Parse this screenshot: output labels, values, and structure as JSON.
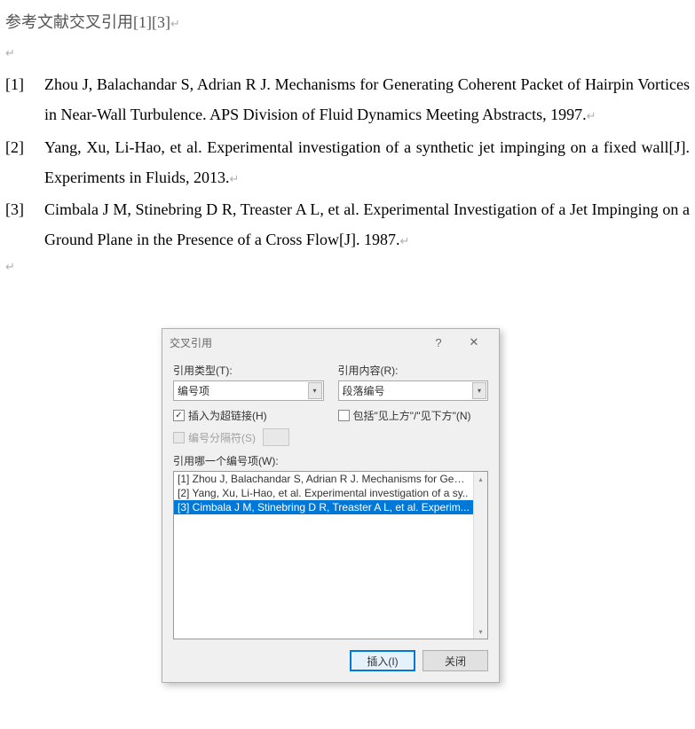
{
  "document": {
    "heading": "参考文献交叉引用[1][3]",
    "references": [
      {
        "num": "[1]",
        "text": "Zhou J, Balachandar S, Adrian R J. Mechanisms for Generating Coherent Packet of Hairpin Vortices in Near-Wall Turbulence. APS Division of Fluid Dynamics Meeting Abstracts, 1997."
      },
      {
        "num": "[2]",
        "text": "Yang, Xu, Li-Hao, et al. Experimental investigation of a synthetic jet impinging on a fixed wall[J]. Experiments in Fluids, 2013."
      },
      {
        "num": "[3]",
        "text": "Cimbala J M, Stinebring D R, Treaster A L, et al. Experimental Investigation of a Jet Impinging on a Ground Plane in the Presence of a Cross Flow[J]. 1987."
      }
    ],
    "paragraph_mark": "↵"
  },
  "dialog": {
    "title": "交叉引用",
    "help": "?",
    "close_icon": "✕",
    "labels": {
      "ref_type": "引用类型(T):",
      "ref_content": "引用内容(R):",
      "insert_hyperlink": "插入为超链接(H)",
      "include_above_below": "包括\"见上方\"/\"见下方\"(N)",
      "num_separator": "编号分隔符(S)",
      "which_item": "引用哪一个编号项(W):"
    },
    "combos": {
      "ref_type_value": "编号项",
      "ref_content_value": "段落编号"
    },
    "list_items": [
      "[1] Zhou J, Balachandar S, Adrian R J. Mechanisms for Gene...",
      "[2] Yang, Xu, Li-Hao, et al. Experimental investigation of a sy..",
      "[3] Cimbala J M, Stinebring D R, Treaster A L, et al. Experim..."
    ],
    "selected_index": 2,
    "buttons": {
      "insert": "插入(I)",
      "close": "关闭"
    }
  }
}
